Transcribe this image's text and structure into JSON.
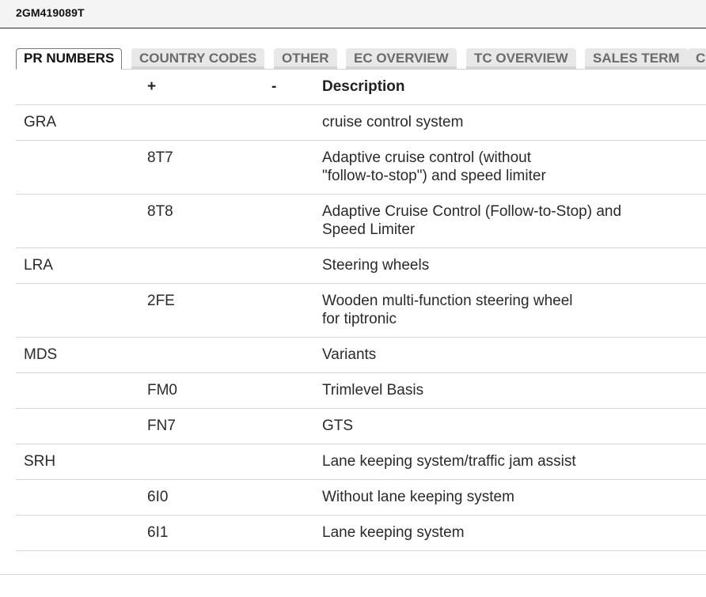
{
  "header": {
    "title": "2GM419089T"
  },
  "tabs": [
    {
      "label": "PR NUMBERS",
      "active": true
    },
    {
      "label": "COUNTRY CODES",
      "active": false
    },
    {
      "label": "OTHER",
      "active": false
    },
    {
      "label": "EC OVERVIEW",
      "active": false
    },
    {
      "label": "TC OVERVIEW",
      "active": false
    },
    {
      "label": "SALES TERM",
      "active": false
    },
    {
      "label": "C",
      "active": false
    }
  ],
  "table": {
    "columns": [
      "",
      "+",
      "-",
      "Description"
    ],
    "rows": [
      {
        "family": "GRA",
        "plus": "",
        "minus": "",
        "description": "cruise control system"
      },
      {
        "family": "",
        "plus": "8T7",
        "minus": "",
        "description": "Adaptive cruise control (without\n\"follow-to-stop\") and speed limiter"
      },
      {
        "family": "",
        "plus": "8T8",
        "minus": "",
        "description": "Adaptive Cruise Control (Follow-to-Stop) and\nSpeed Limiter"
      },
      {
        "family": "LRA",
        "plus": "",
        "minus": "",
        "description": "Steering wheels"
      },
      {
        "family": "",
        "plus": "2FE",
        "minus": "",
        "description": "Wooden multi-function steering wheel\nfor tiptronic"
      },
      {
        "family": "MDS",
        "plus": "",
        "minus": "",
        "description": "Variants"
      },
      {
        "family": "",
        "plus": "FM0",
        "minus": "",
        "description": "Trimlevel Basis"
      },
      {
        "family": "",
        "plus": "FN7",
        "minus": "",
        "description": "GTS"
      },
      {
        "family": "SRH",
        "plus": "",
        "minus": "",
        "description": "Lane keeping system/traffic jam assist"
      },
      {
        "family": "",
        "plus": "6I0",
        "minus": "",
        "description": "Without lane keeping system"
      },
      {
        "family": "",
        "plus": "6I1",
        "minus": "",
        "description": "Lane keeping system"
      }
    ]
  },
  "colors": {
    "header_bg": "#f4f4f4",
    "tab_bg": "#e8e8e8",
    "tab_text": "#6b6b6b",
    "active_tab_text": "#111111",
    "row_border": "#d6d6d6"
  }
}
